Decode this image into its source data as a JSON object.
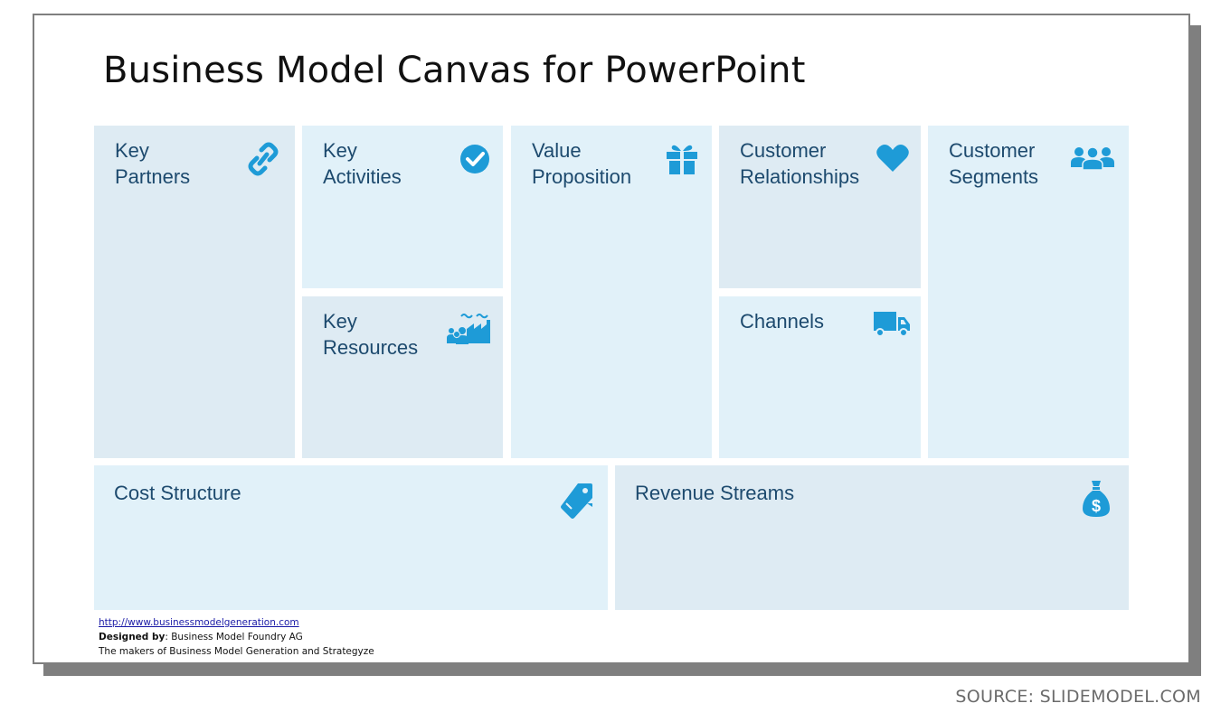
{
  "slide": {
    "title": "Business Model Canvas for PowerPoint"
  },
  "colors": {
    "icon": "#1e9bd7",
    "label": "#1d4a6e",
    "cell_dark": "#deebf3",
    "cell_light": "#e1f1f9"
  },
  "blocks": {
    "key_partners": {
      "label": "Key\nPartners",
      "icon": "link-icon"
    },
    "key_activities": {
      "label": "Key\nActivities",
      "icon": "check-circle-icon"
    },
    "key_resources": {
      "label": "Key\nResources",
      "icon": "factory-people-icon"
    },
    "value_proposition": {
      "label": "Value\nProposition",
      "icon": "gift-icon"
    },
    "customer_relationships": {
      "label": "Customer\nRelationships",
      "icon": "heart-icon"
    },
    "channels": {
      "label": "Channels",
      "icon": "truck-icon"
    },
    "customer_segments": {
      "label": "Customer\nSegments",
      "icon": "users-icon"
    },
    "cost_structure": {
      "label": "Cost Structure",
      "icon": "price-tag-icon"
    },
    "revenue_streams": {
      "label": "Revenue Streams",
      "icon": "money-bag-icon"
    }
  },
  "footer": {
    "url": "http://www.businessmodelgeneration.com",
    "designed_by_label": "Designed by",
    "designed_by_value": ": Business Model Foundry AG",
    "makers": "The makers of Business Model Generation and Strategyze"
  },
  "source": "SOURCE: SLIDEMODEL.COM"
}
